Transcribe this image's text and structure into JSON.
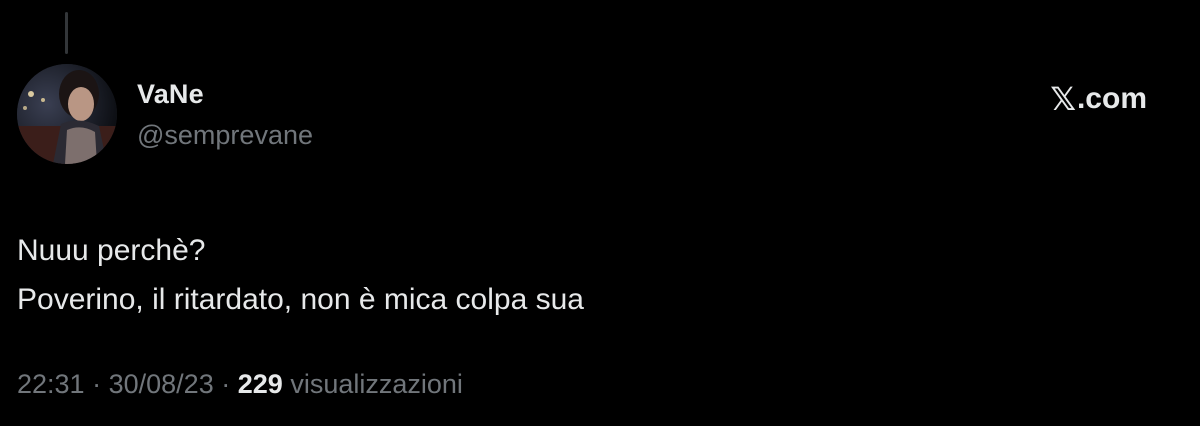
{
  "author": {
    "display_name": "VaNe",
    "handle": "@semprevane",
    "avatar_icon": "profile-photo"
  },
  "brand": {
    "x_glyph": "𝕏",
    "domain": ".com"
  },
  "tweet": {
    "lines": [
      "Nuuu perchè?",
      "Poverino, il ritardato, non è mica colpa sua"
    ]
  },
  "meta": {
    "time": "22:31",
    "separator": "·",
    "date": "30/08/23",
    "views_count": "229",
    "views_label": "visualizzazioni"
  },
  "colors": {
    "background": "#000000",
    "primary_text": "#e7e9ea",
    "secondary_text": "#71767b",
    "thread_line": "#333639"
  }
}
